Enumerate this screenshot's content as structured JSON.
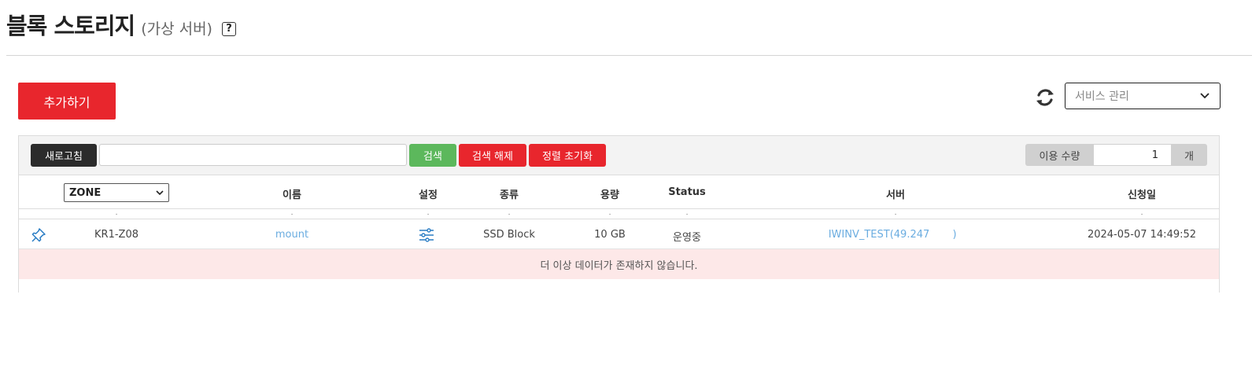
{
  "header": {
    "title": "블록 스토리지",
    "subtitle": "(가상 서버)",
    "help_label": "?"
  },
  "actions": {
    "add_label": "추가하기",
    "refresh_icon": "refresh-icon",
    "service_select": {
      "value": "서비스 관리",
      "icon": "chevron-down-icon"
    }
  },
  "toolbar": {
    "refresh_label": "새로고침",
    "search_value": "",
    "search_label": "검색",
    "clear_label": "검색 해제",
    "sort_reset_label": "정렬 초기화",
    "usage": {
      "label": "이용 수량",
      "value": "1",
      "unit": "개"
    }
  },
  "table": {
    "zone_filter": {
      "value": "ZONE",
      "icon": "chevron-down-icon"
    },
    "columns": [
      "이름",
      "설정",
      "종류",
      "용량",
      "Status",
      "서버",
      "신청일"
    ],
    "filter_marks": [
      ".",
      ".",
      ".",
      ".",
      ".",
      ".",
      ".",
      "."
    ],
    "rows": [
      {
        "pin_icon": "pin-icon",
        "zone": "KR1-Z08",
        "name": "mount",
        "settings_icon": "sliders-icon",
        "type": "SSD Block",
        "capacity": "10 GB",
        "status": "운영중",
        "server": "IWINV_TEST(49.247",
        "server_tail": ")",
        "date": "2024-05-07 14:49:52"
      }
    ],
    "empty_message": "더 이상 데이터가 존재하지 않습니다."
  },
  "colors": {
    "primary_red": "#e8262d",
    "dark_button": "#2b2b2b",
    "search_green": "#5cb85c",
    "link_blue": "#6aace0",
    "empty_row_bg": "#fde8e8"
  }
}
